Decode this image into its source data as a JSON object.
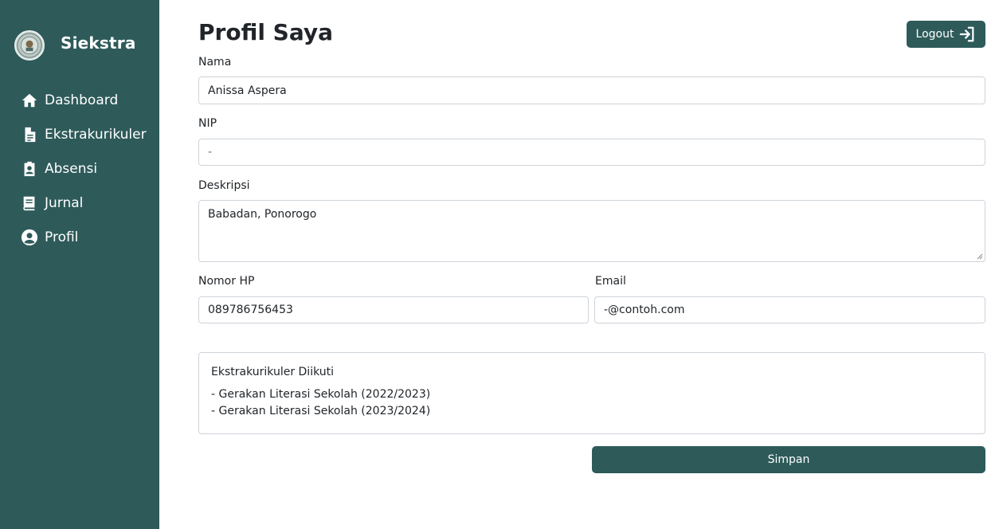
{
  "app": {
    "brand_name": "Siekstra",
    "logo_icon": "school-seal-logo"
  },
  "sidebar": {
    "items": [
      {
        "label": "Dashboard",
        "icon": "home-icon"
      },
      {
        "label": "Ekstrakurikuler",
        "icon": "document-icon"
      },
      {
        "label": "Absensi",
        "icon": "id-badge-icon"
      },
      {
        "label": "Jurnal",
        "icon": "journal-icon"
      },
      {
        "label": "Profil",
        "icon": "user-circle-icon"
      }
    ]
  },
  "header": {
    "title": "Profil Saya",
    "logout_label": "Logout",
    "logout_icon": "sign-in-arrow-icon"
  },
  "form": {
    "nama": {
      "label": "Nama",
      "value": "Anissa Aspera"
    },
    "nip": {
      "label": "NIP",
      "value": "-"
    },
    "deskripsi": {
      "label": "Deskripsi",
      "value": "Babadan, Ponorogo"
    },
    "nomor_hp": {
      "label": "Nomor HP",
      "value": "089786756453"
    },
    "email": {
      "label": "Email",
      "value": "-@contoh.com"
    }
  },
  "ekstrakurikuler": {
    "title": "Ekstrakurikuler Diikuti",
    "items": [
      "- Gerakan Literasi Sekolah (2022/2023)",
      "- Gerakan Literasi Sekolah (2023/2024)"
    ]
  },
  "actions": {
    "save_label": "Simpan"
  },
  "colors": {
    "primary": "#2e5a5a",
    "border": "#ced4da",
    "text": "#212529"
  }
}
